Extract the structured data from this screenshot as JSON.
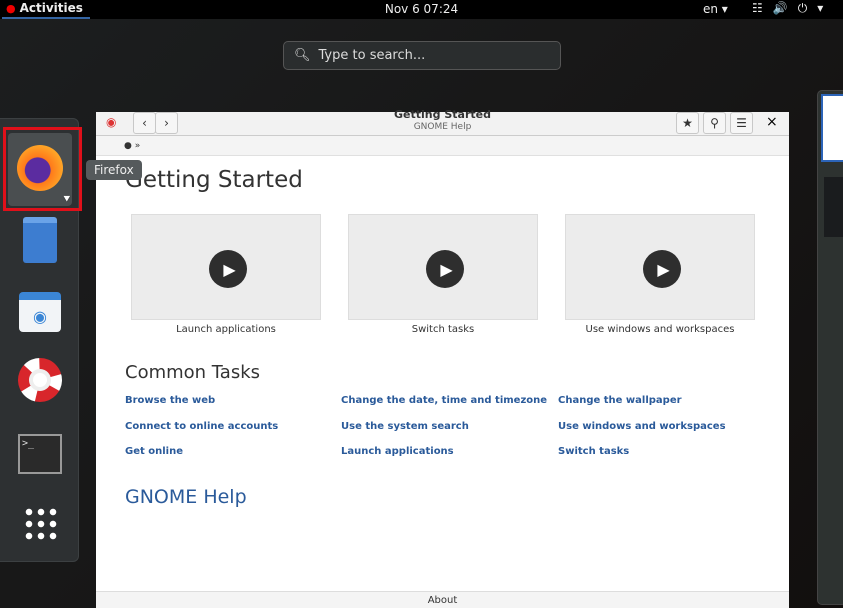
{
  "topbar": {
    "activities": "Activities",
    "clock": "Nov 6  07:24",
    "language": "en ▾",
    "power_menu": "▾"
  },
  "search": {
    "placeholder": "Type to search..."
  },
  "dock": {
    "tooltip": "Firefox",
    "items": [
      "Firefox",
      "Files",
      "Software",
      "Help",
      "Terminal",
      "Show Applications"
    ]
  },
  "window": {
    "title": "Getting Started",
    "subtitle": "GNOME Help",
    "breadcrumb_sep": "»",
    "close": "×",
    "heading": "Getting Started",
    "videos": [
      {
        "label": "Launch applications"
      },
      {
        "label": "Switch tasks"
      },
      {
        "label": "Use windows and workspaces"
      }
    ],
    "common_tasks": "Common Tasks",
    "links": [
      [
        "Browse the web",
        "Change the date, time and timezone",
        "Change the wallpaper"
      ],
      [
        "Connect to online accounts",
        "Use the system search",
        "Use windows and workspaces"
      ],
      [
        "Get online",
        "Launch applications",
        "Switch tasks"
      ]
    ],
    "gnome_help": "GNOME Help",
    "about": "About"
  }
}
